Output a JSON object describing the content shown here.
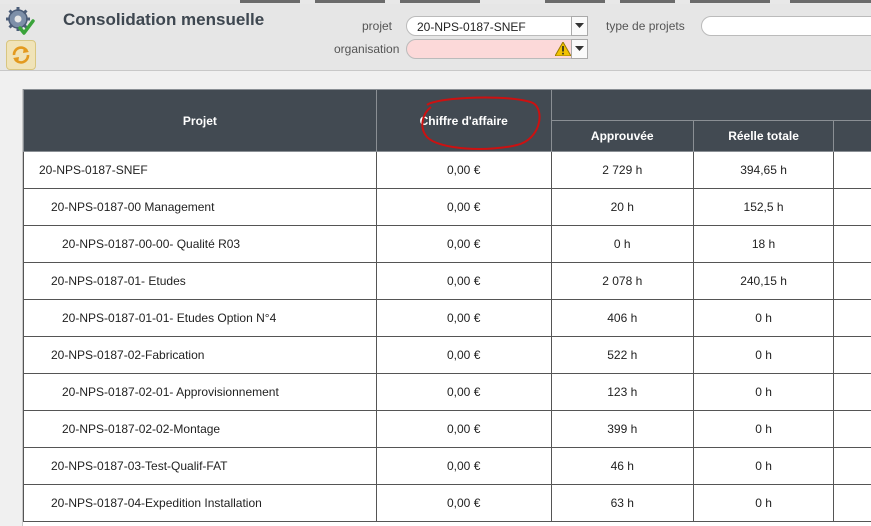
{
  "header": {
    "title": "Consolidation mensuelle",
    "projet_label": "projet",
    "projet_value": "20-NPS-0187-SNEF",
    "type_label": "type de projets",
    "type_value": "",
    "organisation_label": "organisation",
    "organisation_value": ""
  },
  "table": {
    "col_projet": "Projet",
    "col_ca": "Chiffre d'affaire",
    "col_approuvee": "Approuvée",
    "col_reelle": "Réelle totale",
    "rows": [
      {
        "name": "20-NPS-0187-SNEF",
        "level": 0,
        "ca": "0,00 €",
        "approuvee": "2 729 h",
        "reelle": "394,65 h"
      },
      {
        "name": "20-NPS-0187-00 Management",
        "level": 1,
        "ca": "0,00 €",
        "approuvee": "20 h",
        "reelle": "152,5 h"
      },
      {
        "name": "20-NPS-0187-00-00- Qualité R03",
        "level": 2,
        "ca": "0,00 €",
        "approuvee": "0 h",
        "reelle": "18 h"
      },
      {
        "name": "20-NPS-0187-01- Etudes",
        "level": 1,
        "ca": "0,00 €",
        "approuvee": "2 078 h",
        "reelle": "240,15 h"
      },
      {
        "name": "20-NPS-0187-01-01- Etudes Option N°4",
        "level": 2,
        "ca": "0,00 €",
        "approuvee": "406 h",
        "reelle": "0 h"
      },
      {
        "name": "20-NPS-0187-02-Fabrication",
        "level": 1,
        "ca": "0,00 €",
        "approuvee": "522 h",
        "reelle": "0 h"
      },
      {
        "name": "20-NPS-0187-02-01- Approvisionnement",
        "level": 2,
        "ca": "0,00 €",
        "approuvee": "123 h",
        "reelle": "0 h"
      },
      {
        "name": "20-NPS-0187-02-02-Montage",
        "level": 2,
        "ca": "0,00 €",
        "approuvee": "399 h",
        "reelle": "0 h"
      },
      {
        "name": "20-NPS-0187-03-Test-Qualif-FAT",
        "level": 1,
        "ca": "0,00 €",
        "approuvee": "46 h",
        "reelle": "0 h"
      },
      {
        "name": "20-NPS-0187-04-Expedition Installation",
        "level": 1,
        "ca": "0,00 €",
        "approuvee": "63 h",
        "reelle": "0 h"
      }
    ]
  },
  "colors": {
    "header_bg": "#424a52",
    "warning_field_bg": "#fcd9d9",
    "annotation": "#cc1111"
  },
  "icons": {
    "settings": "gear-check-icon",
    "refresh": "refresh-icon",
    "warning": "warning-icon",
    "dropdown": "chevron-down-icon"
  }
}
